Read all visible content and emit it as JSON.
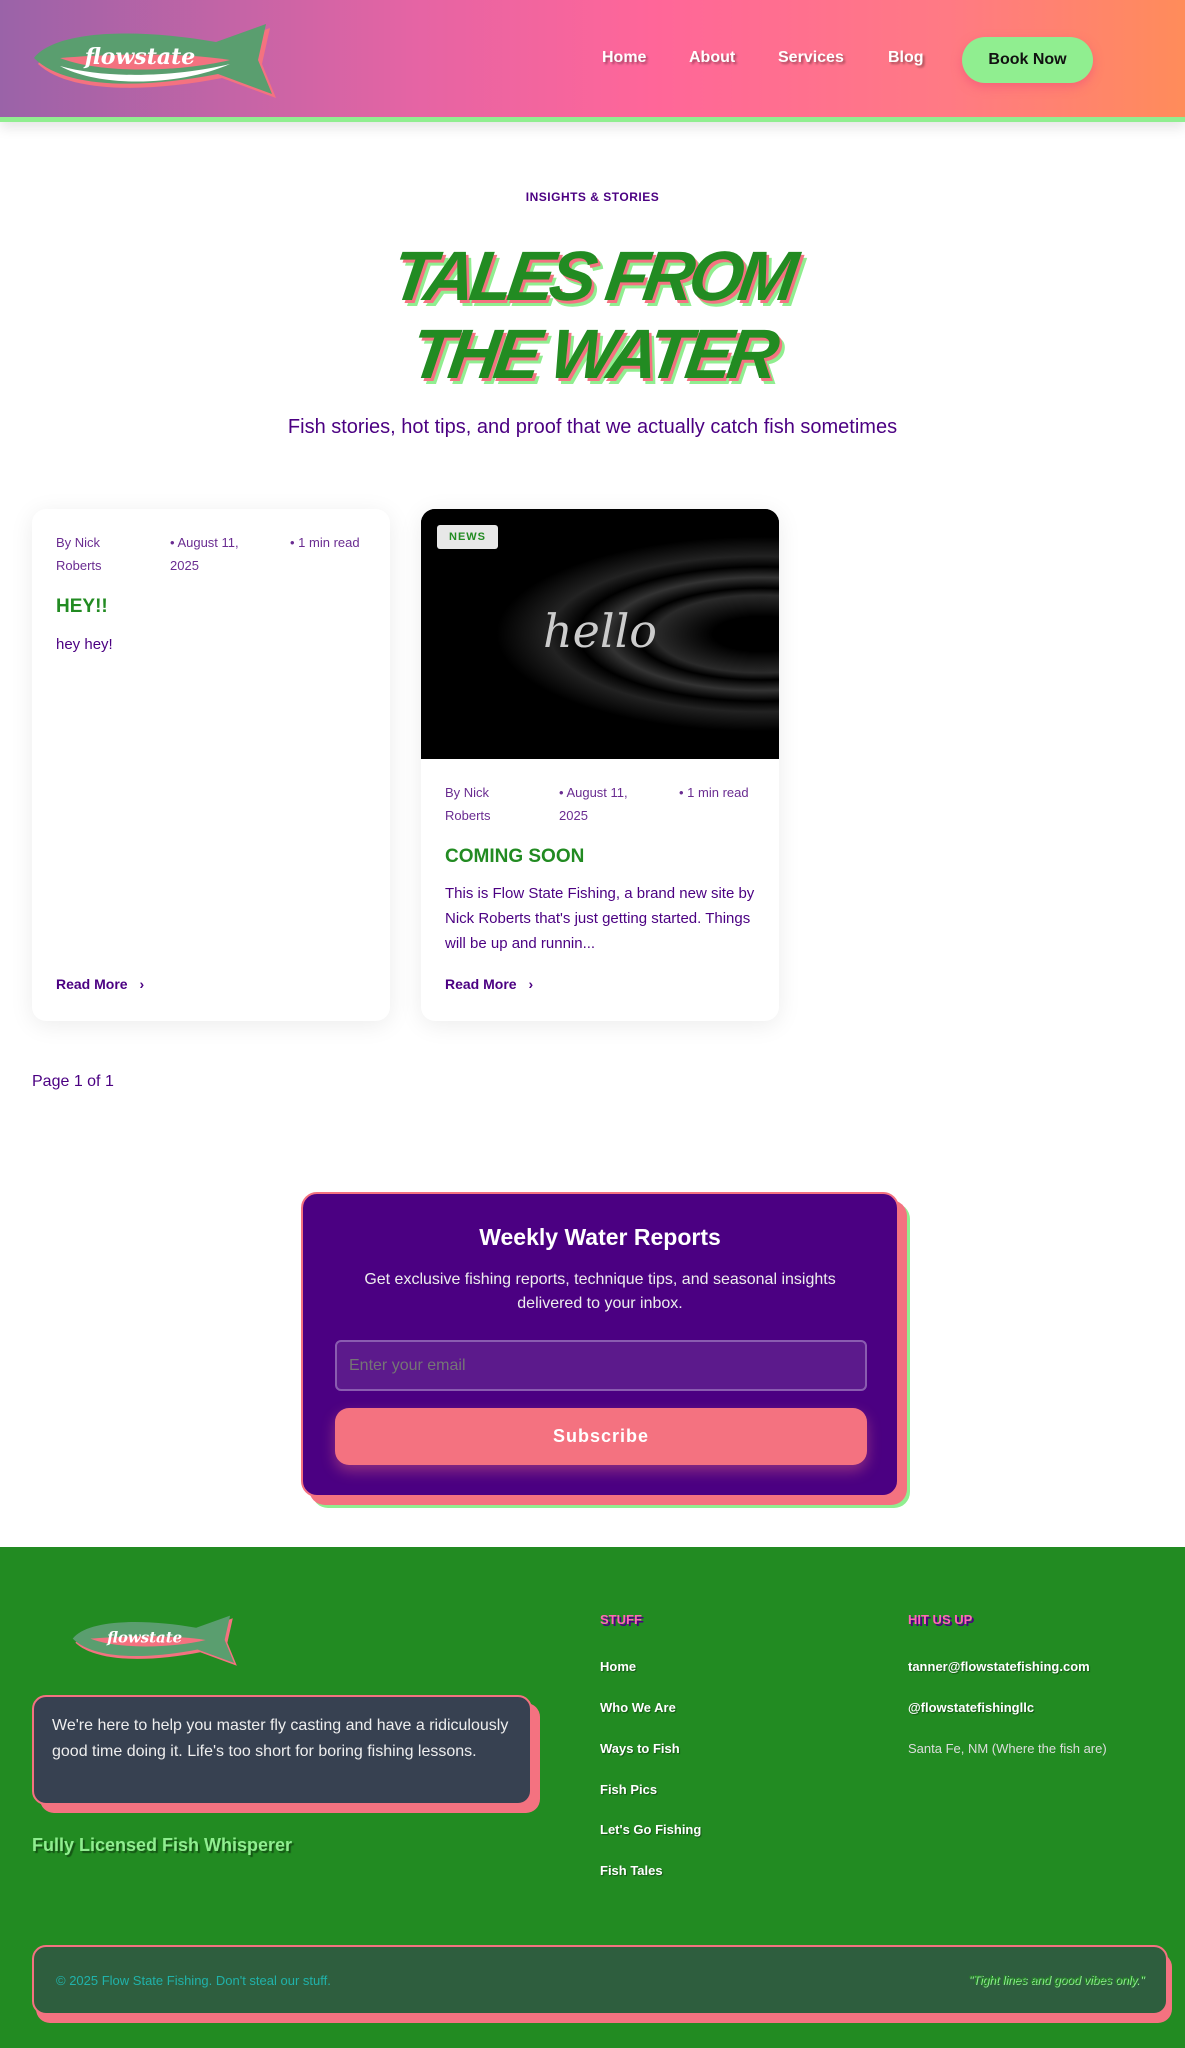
{
  "header": {
    "logo_text": "flowstate",
    "nav": [
      "Home",
      "About",
      "Services",
      "Blog"
    ],
    "cta": "Book Now"
  },
  "hero": {
    "eyebrow": "INSIGHTS & STORIES",
    "title_line1": "TALES FROM",
    "title_line2": "THE WATER",
    "subtitle": "Fish stories, hot tips, and proof that we actually catch fish sometimes"
  },
  "posts": [
    {
      "author": "By Nick Roberts",
      "date": "• August 11, 2025",
      "read_time": "• 1 min read",
      "title": "HEY!!",
      "excerpt": "hey hey!",
      "read_more": "Read More"
    },
    {
      "badge": "NEWS",
      "image_text": "hello",
      "author": "By Nick Roberts",
      "date": "• August 11, 2025",
      "read_time": "• 1 min read",
      "title": "COMING SOON",
      "excerpt": "This is Flow State Fishing, a brand new site by Nick Roberts that's just getting started. Things will be up and runnin...",
      "read_more": "Read More"
    }
  ],
  "pagination": "Page 1 of 1",
  "newsletter": {
    "title": "Weekly Water Reports",
    "text": "Get exclusive fishing reports, technique tips, and seasonal insights delivered to your inbox.",
    "placeholder": "Enter your email",
    "button": "Subscribe"
  },
  "footer": {
    "about": "We're here to help you master fly casting and have a ridiculously good time doing it. Life's too short for boring fishing lessons.",
    "tagline": "Fully Licensed Fish Whisperer",
    "stuff_heading": "STUFF",
    "links": [
      "Home",
      "Who We Are",
      "Ways to Fish",
      "Fish Pics",
      "Let's Go Fishing",
      "Fish Tales"
    ],
    "contact_heading": "HIT US UP",
    "email": "tanner@flowstatefishing.com",
    "social": "@flowstatefishingllc",
    "location": "Santa Fe, NM (Where the fish are)",
    "copyright": "© 2025 Flow State Fishing. Don't steal our stuff.",
    "quote": "\"Tight lines and good vibes only.\""
  },
  "colors": {
    "purple": "#4b0082",
    "green": "#228b22",
    "pink": "#f47280",
    "lightgreen": "#90ee90"
  }
}
